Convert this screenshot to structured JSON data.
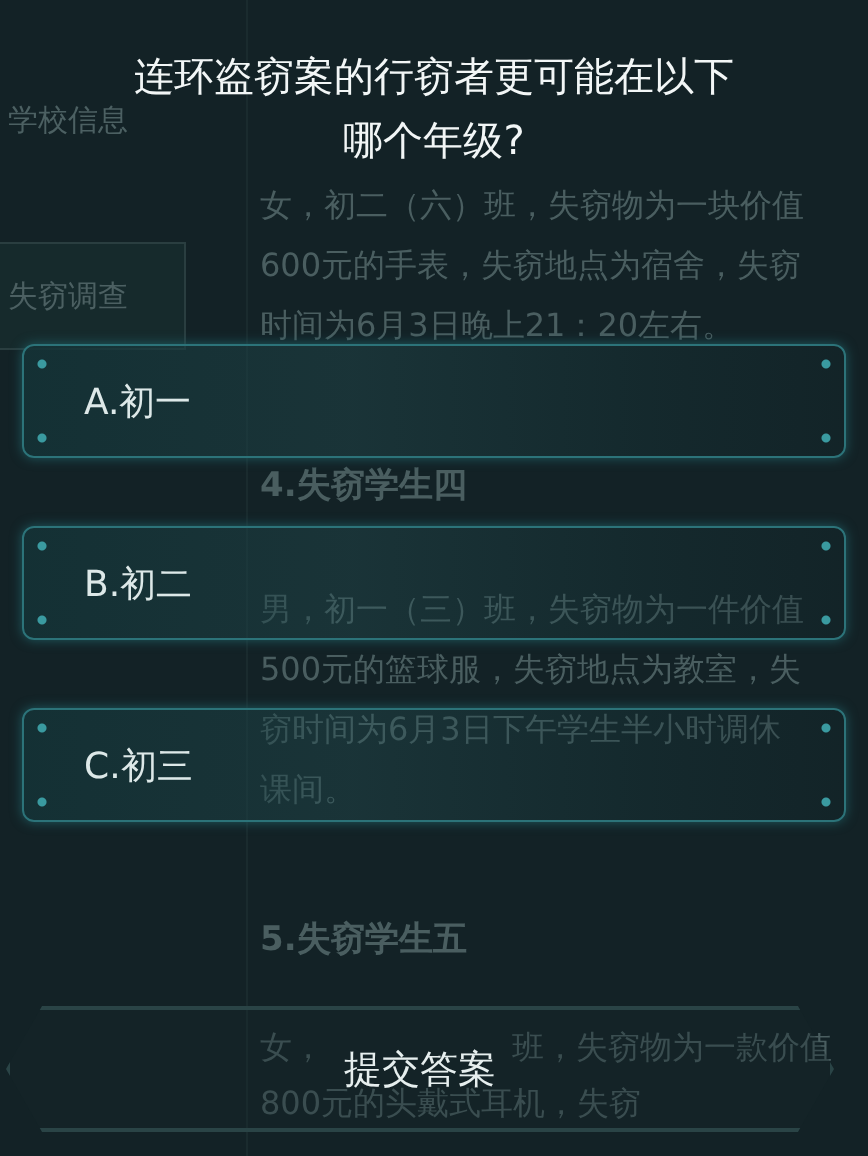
{
  "sidebar": {
    "items": [
      {
        "label": "学校信息",
        "selected": false
      },
      {
        "label": "失窃调查",
        "selected": true
      }
    ]
  },
  "case_text": [
    {
      "kind": "line",
      "text": "女，初二（六）班，失窃物为一块价值"
    },
    {
      "kind": "line",
      "text": "600元的手表，失窃地点为宿舍，失窃"
    },
    {
      "kind": "line",
      "text": "时间为6月3日晚上21：20左右。"
    },
    {
      "kind": "heading",
      "text": "4.失窃学生四"
    },
    {
      "kind": "line",
      "text": "男，初一（三）班，失窃物为一件价值"
    },
    {
      "kind": "line",
      "text": "500元的篮球服，失窃地点为教室，失"
    },
    {
      "kind": "line",
      "text": "窃时间为6月3日下午学生半小时调休"
    },
    {
      "kind": "line",
      "text": "课间。"
    },
    {
      "kind": "heading",
      "text": "5.失窃学生五"
    },
    {
      "kind": "split",
      "before": "女，",
      "after": "班，失窃物为一款价值"
    },
    {
      "kind": "line",
      "text": "800元的头戴式耳机，失窃"
    }
  ],
  "quiz": {
    "question": "连环盗窃案的行窃者更可能在以下哪个年级?",
    "options": [
      {
        "label": "A.初一",
        "selected": false
      },
      {
        "label": "B.初二",
        "selected": false
      },
      {
        "label": "C.初三",
        "selected": false
      }
    ],
    "submit": "提交答案"
  }
}
